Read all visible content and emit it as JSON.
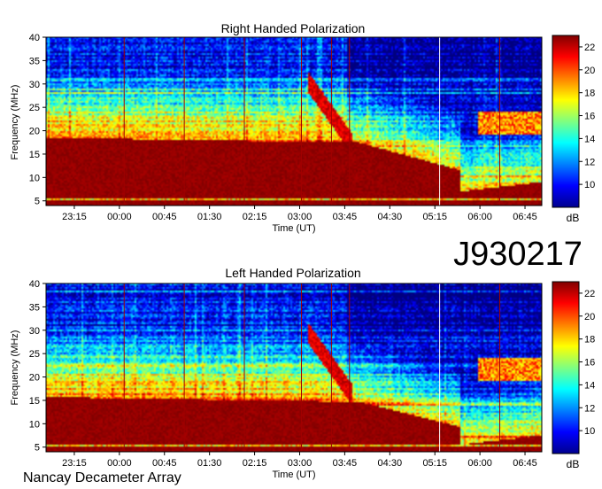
{
  "figure": {
    "observation_id": "J930217",
    "instrument": "Nancay Decameter Array"
  },
  "chart_data": [
    {
      "type": "heatmap",
      "title": "Right Handed Polarization",
      "xlabel": "Time (UT)",
      "ylabel": "Frequency (MHz)",
      "x_ticks": [
        "23:15",
        "00:00",
        "00:45",
        "01:30",
        "02:15",
        "03:00",
        "03:45",
        "04:30",
        "05:15",
        "06:00",
        "06:45"
      ],
      "y_ticks": [
        5,
        10,
        15,
        20,
        25,
        30,
        35,
        40
      ],
      "ylim": [
        4,
        40
      ],
      "colorbar": {
        "ticks": [
          10,
          12,
          14,
          16,
          18,
          20,
          22
        ],
        "range": [
          8,
          23
        ],
        "unit": "dB"
      },
      "description": "Intense emission (>22 dB) below ~17-20 MHz through most of the night, drifting burst feature near 03:15-03:45 reaching ~27 MHz, emission fading toward 06:45."
    },
    {
      "type": "heatmap",
      "title": "Left Handed Polarization",
      "xlabel": "Time (UT)",
      "ylabel": "Frequency (MHz)",
      "x_ticks": [
        "23:15",
        "00:00",
        "00:45",
        "01:30",
        "02:15",
        "03:00",
        "03:45",
        "04:30",
        "05:15",
        "06:00",
        "06:45"
      ],
      "y_ticks": [
        5,
        10,
        15,
        20,
        25,
        30,
        35,
        40
      ],
      "ylim": [
        4,
        40
      ],
      "colorbar": {
        "ticks": [
          10,
          12,
          14,
          16,
          18,
          20,
          22
        ],
        "range": [
          8,
          23
        ],
        "unit": "dB"
      },
      "description": "Intense emission below ~16 MHz through most of the night, drifting burst feature near 03:30 reaching ~26 MHz, weaker emission after 05:00."
    }
  ]
}
